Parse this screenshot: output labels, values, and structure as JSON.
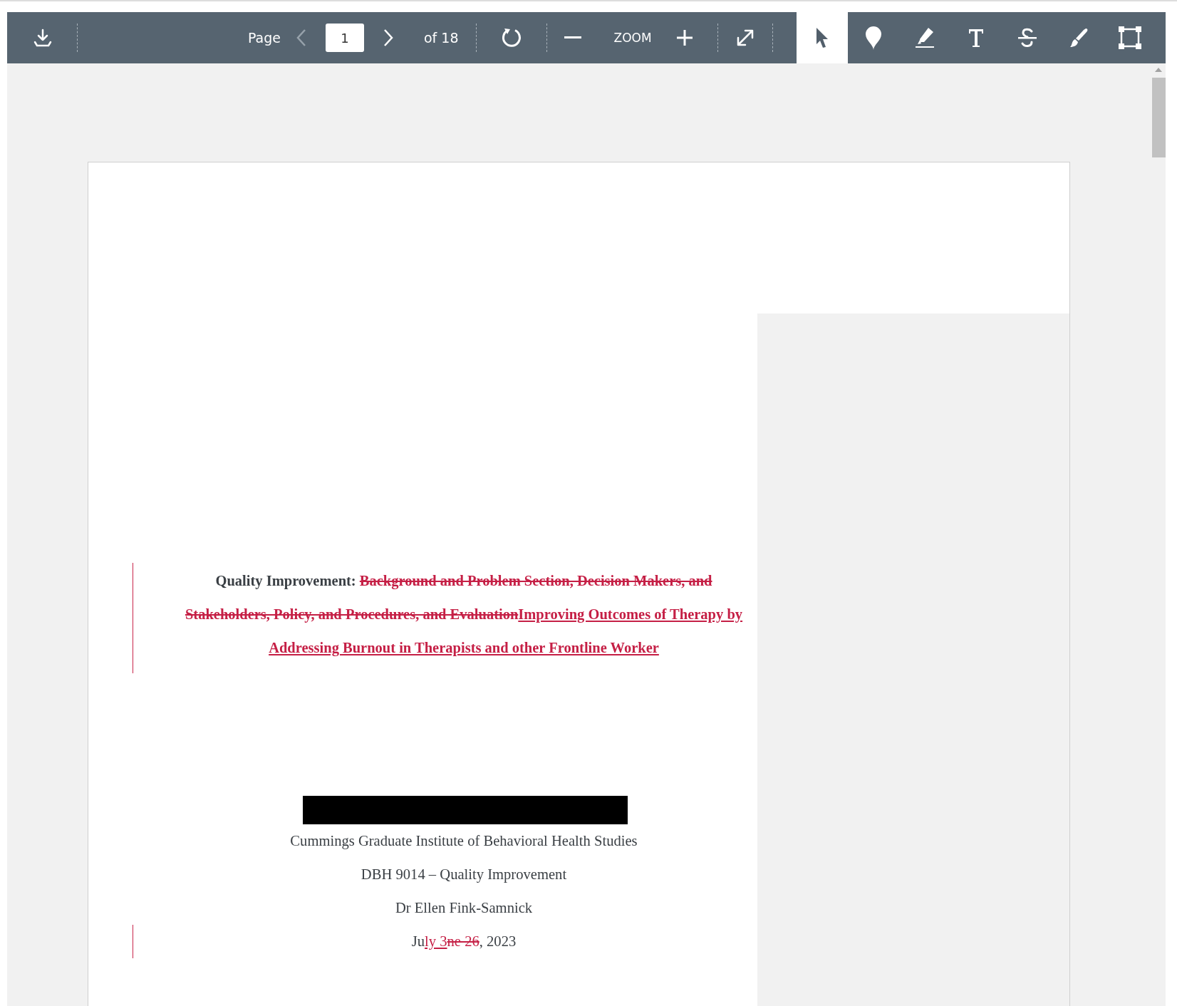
{
  "toolbar": {
    "page_label": "Page",
    "page_value": "1",
    "page_total": "of 18",
    "zoom_label": "ZOOM",
    "tools": [
      {
        "kind": "select",
        "selected": true
      },
      {
        "kind": "pin",
        "selected": false
      },
      {
        "kind": "highlight",
        "selected": false
      },
      {
        "kind": "text",
        "selected": false
      },
      {
        "kind": "strikeout",
        "selected": false
      },
      {
        "kind": "draw",
        "selected": false
      },
      {
        "kind": "area",
        "selected": false
      }
    ]
  },
  "document": {
    "title_runs": [
      {
        "kind": "plain",
        "text": "Quality Improvement: "
      },
      {
        "kind": "deleted",
        "text": "Background and Problem Section, Decision Makers, and Stakeholders, Policy, and Procedures, and Evaluation"
      },
      {
        "kind": "inserted",
        "text": "Improving Outcomes of Therapy by Addressing Burnout in Therapists and other Frontline Worker"
      }
    ],
    "lines": [
      "Cummings Graduate Institute of Behavioral Health Studies",
      "DBH 9014 – Quality Improvement",
      "Dr Ellen Fink-Samnick"
    ],
    "date_runs": [
      {
        "kind": "plain",
        "text": "Ju"
      },
      {
        "kind": "inserted",
        "text": "ly 3"
      },
      {
        "kind": "deleted",
        "text": "ne 26"
      },
      {
        "kind": "plain",
        "text": ", 2023"
      }
    ]
  }
}
